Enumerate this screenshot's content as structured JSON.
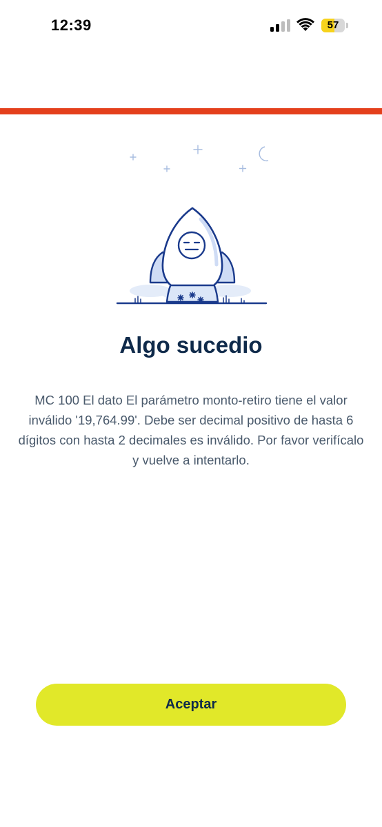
{
  "status_bar": {
    "time": "12:39",
    "battery_percent": 57,
    "battery_label": "57",
    "signal_bars_active": 2,
    "signal_bars_total": 4,
    "icons": [
      "cellular-signal-icon",
      "wifi-icon",
      "battery-charging-icon"
    ]
  },
  "colors": {
    "accent_line": "#e4401c",
    "title": "#0f2a4a",
    "message": "#4a5a6c",
    "button_bg": "#e1e829",
    "button_text": "#0f2a4a",
    "illustration_stroke": "#1a3a8c",
    "illustration_fill": "#dbe6f8"
  },
  "illustration": {
    "icon": "rocket-illustration"
  },
  "error": {
    "title": "Algo sucedio",
    "message": "MC 100 El dato El parámetro monto-retiro tiene el valor inválido '19,764.99'. Debe ser decimal positivo de hasta 6 dígitos con hasta 2 decimales es inválido. Por favor verifícalo y vuelve a intentarlo."
  },
  "actions": {
    "accept_label": "Aceptar"
  }
}
